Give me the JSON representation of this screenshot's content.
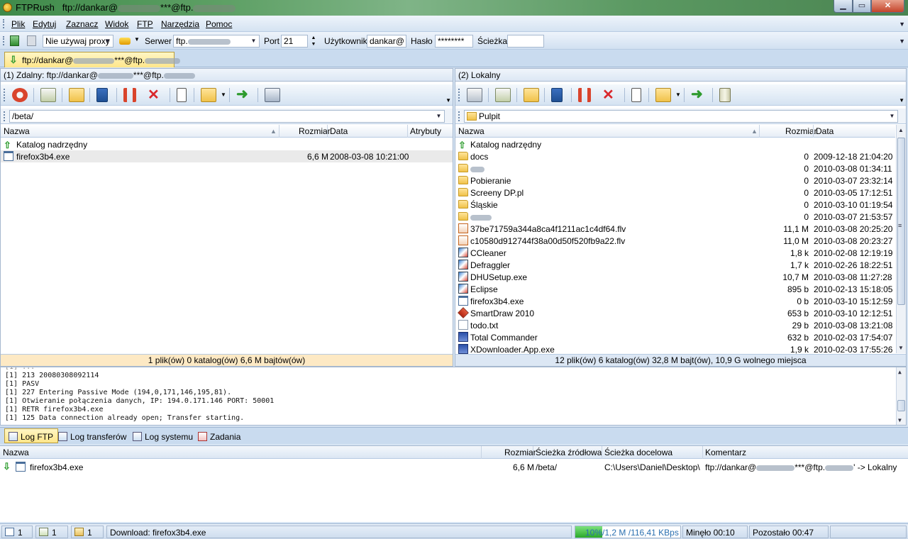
{
  "window": {
    "app_name": "FTPRush",
    "title_conn": "ftp://dankar@",
    "title_conn_mid": "***@ftp."
  },
  "menu": [
    "Plik",
    "Edytuj",
    "Zaznacz",
    "Widok",
    "FTP",
    "Narzędzia",
    "Pomoc"
  ],
  "connect": {
    "proxy_value": "Nie używaj proxy",
    "server_label": "Serwer",
    "server_value": "ftp.",
    "port_label": "Port",
    "port_value": "21",
    "user_label": "Użytkownik",
    "user_value": "dankar@",
    "pass_label": "Hasło",
    "pass_value": "********",
    "path_label": "Ścieżka",
    "path_value": ""
  },
  "tab": {
    "label_a": "ftp://dankar@",
    "label_b": "***@ftp."
  },
  "remote": {
    "header_a": "(1) Zdalny:  ftp://dankar@",
    "header_b": "***@ftp.",
    "path": "/beta/",
    "columns": [
      "Nazwa",
      "Rozmiar",
      "Data",
      "Atrybuty"
    ],
    "parent": "Katalog nadrzędny",
    "files": [
      {
        "name": "firefox3b4.exe",
        "size": "6,6 M",
        "date": "2008-03-08 10:21:00",
        "icon": "exe-icon"
      }
    ],
    "summary": "1 plik(ów) 0 katalog(ów) 6,6 M bajtów(ów)"
  },
  "local": {
    "header": "(2) Lokalny",
    "path": "Pulpit",
    "columns": [
      "Nazwa",
      "Rozmiar",
      "Data"
    ],
    "parent": "Katalog nadrzędny",
    "files": [
      {
        "name": "docs",
        "size": "0",
        "date": "2009-12-18 21:04:20",
        "icon": "folder-icon"
      },
      {
        "name": "",
        "size": "0",
        "date": "2010-03-08 01:34:11",
        "icon": "folder-icon"
      },
      {
        "name": "Pobieranie",
        "size": "0",
        "date": "2010-03-07 23:32:14",
        "icon": "folder-icon"
      },
      {
        "name": "Screeny DP.pl",
        "size": "0",
        "date": "2010-03-05 17:12:51",
        "icon": "folder-icon"
      },
      {
        "name": "Śląskie",
        "size": "0",
        "date": "2010-03-10 01:19:54",
        "icon": "folder-icon"
      },
      {
        "name": "",
        "size": "0",
        "date": "2010-03-07 21:53:57",
        "icon": "folder-icon"
      },
      {
        "name": "37be71759a344a8ca4f1211ac1c4df64.flv",
        "size": "11,1 M",
        "date": "2010-03-08 20:25:20",
        "icon": "flv-icon"
      },
      {
        "name": "c10580d912744f38a00d50f520fb9a22.flv",
        "size": "11,0 M",
        "date": "2010-03-08 20:23:27",
        "icon": "flv-icon"
      },
      {
        "name": "CCleaner",
        "size": "1,8 k",
        "date": "2010-02-08 12:19:19",
        "icon": "shortcut-icon"
      },
      {
        "name": "Defraggler",
        "size": "1,7 k",
        "date": "2010-02-26 18:22:51",
        "icon": "shortcut-icon"
      },
      {
        "name": "DHUSetup.exe",
        "size": "10,7 M",
        "date": "2010-03-08 11:27:28",
        "icon": "setup-icon"
      },
      {
        "name": "Eclipse",
        "size": "895 b",
        "date": "2010-02-13 15:18:05",
        "icon": "shortcut-icon"
      },
      {
        "name": "firefox3b4.exe",
        "size": "0 b",
        "date": "2010-03-10 15:12:59",
        "icon": "exe-icon"
      },
      {
        "name": "SmartDraw 2010",
        "size": "653 b",
        "date": "2010-03-10 12:12:51",
        "icon": "smartdraw-icon"
      },
      {
        "name": "todo.txt",
        "size": "29 b",
        "date": "2010-03-08 13:21:08",
        "icon": "text-file-icon"
      },
      {
        "name": "Total Commander",
        "size": "632 b",
        "date": "2010-02-03 17:54:07",
        "icon": "total-commander-icon"
      },
      {
        "name": "XDownloader.App.exe",
        "size": "1,9 k",
        "date": "2010-02-03 17:55:26",
        "icon": "disk-icon"
      }
    ],
    "summary": "12 plik(ów) 6 katalog(ów) 32,8 M bajt(ów), 10,9 G wolnego miejsca"
  },
  "log": {
    "lines": [
      "[1] 213 20080308092114",
      "[1] PASV",
      "[1] 227 Entering Passive Mode (194,0,171,146,195,81).",
      "[1] Otwieranie połączenia danych, IP: 194.0.171.146 PORT: 50001",
      "[1] RETR firefox3b4.exe",
      "[1] 125 Data connection already open; Transfer starting."
    ]
  },
  "log_tabs": [
    "Log FTP",
    "Log transferów",
    "Log systemu",
    "Zadania"
  ],
  "queue": {
    "columns": [
      "Nazwa",
      "Rozmiar",
      "Ścieżka źródłowa",
      "Ścieżka docelowa",
      "Komentarz"
    ],
    "items": [
      {
        "name": "firefox3b4.exe",
        "size": "6,6 M",
        "source": "/beta/",
        "target": "C:\\Users\\Daniel\\Desktop\\",
        "comment_a": "ftp://dankar@",
        "comment_b": "***@ftp.",
        "comment_c": "' -> Lokalny"
      }
    ]
  },
  "status": {
    "count1": "1",
    "count2": "1",
    "count3": "1",
    "download": "Download: firefox3b4.exe",
    "progress_text": "10%/1,2 M /116,41 KBps",
    "progress_fraction": 0.1,
    "elapsed": "Minęło 00:10",
    "remaining": "Pozostało 00:47"
  }
}
